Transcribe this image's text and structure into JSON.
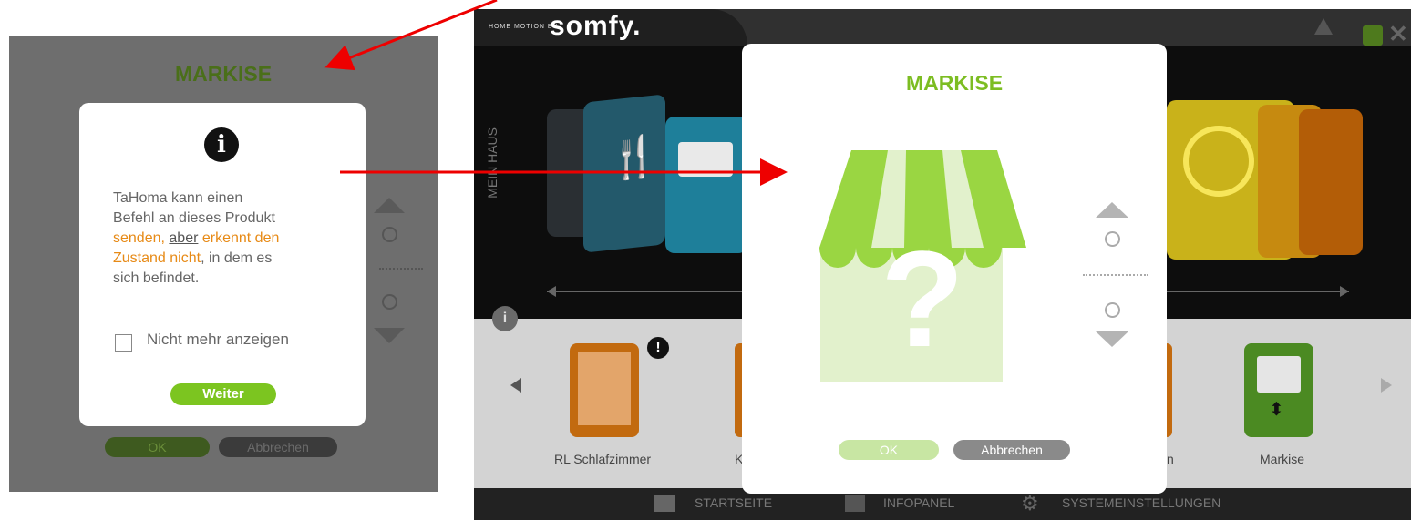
{
  "left_panel": {
    "title": "MARKISE",
    "ok_label": "OK",
    "cancel_label": "Abbrechen",
    "info_dialog": {
      "text_1": "TaHoma kann einen",
      "text_2": "Befehl an dieses Produkt",
      "text_3a": "senden, ",
      "text_3b": "aber",
      "text_3c": " erkennt den",
      "text_4a": "Zustand nicht",
      "text_4b": ", in dem es",
      "text_5": "sich befindet.",
      "checkbox_label": "Nicht mehr anzeigen",
      "checkbox_checked": false,
      "continue_label": "Weiter"
    }
  },
  "app": {
    "logo_small": "HOME MOTION BY",
    "logo": "somfy.",
    "side_label": "MEIN HAUS",
    "devices": [
      {
        "label": "RL Schlafzimmer"
      },
      {
        "label": "Ka"
      },
      {
        "label": "n"
      },
      {
        "label": "Markise"
      }
    ],
    "footer": {
      "home": "STARTSEITE",
      "info": "INFOPANEL",
      "settings": "SYSTEMEINSTELLUNGEN"
    },
    "markise_dialog": {
      "title": "MARKISE",
      "ok_label": "OK",
      "cancel_label": "Abbrechen"
    }
  },
  "colors": {
    "accent_green": "#7cc520",
    "title_green": "#7cbd22",
    "warning_orange": "#e78a16",
    "annotation_red": "#ee0000"
  }
}
